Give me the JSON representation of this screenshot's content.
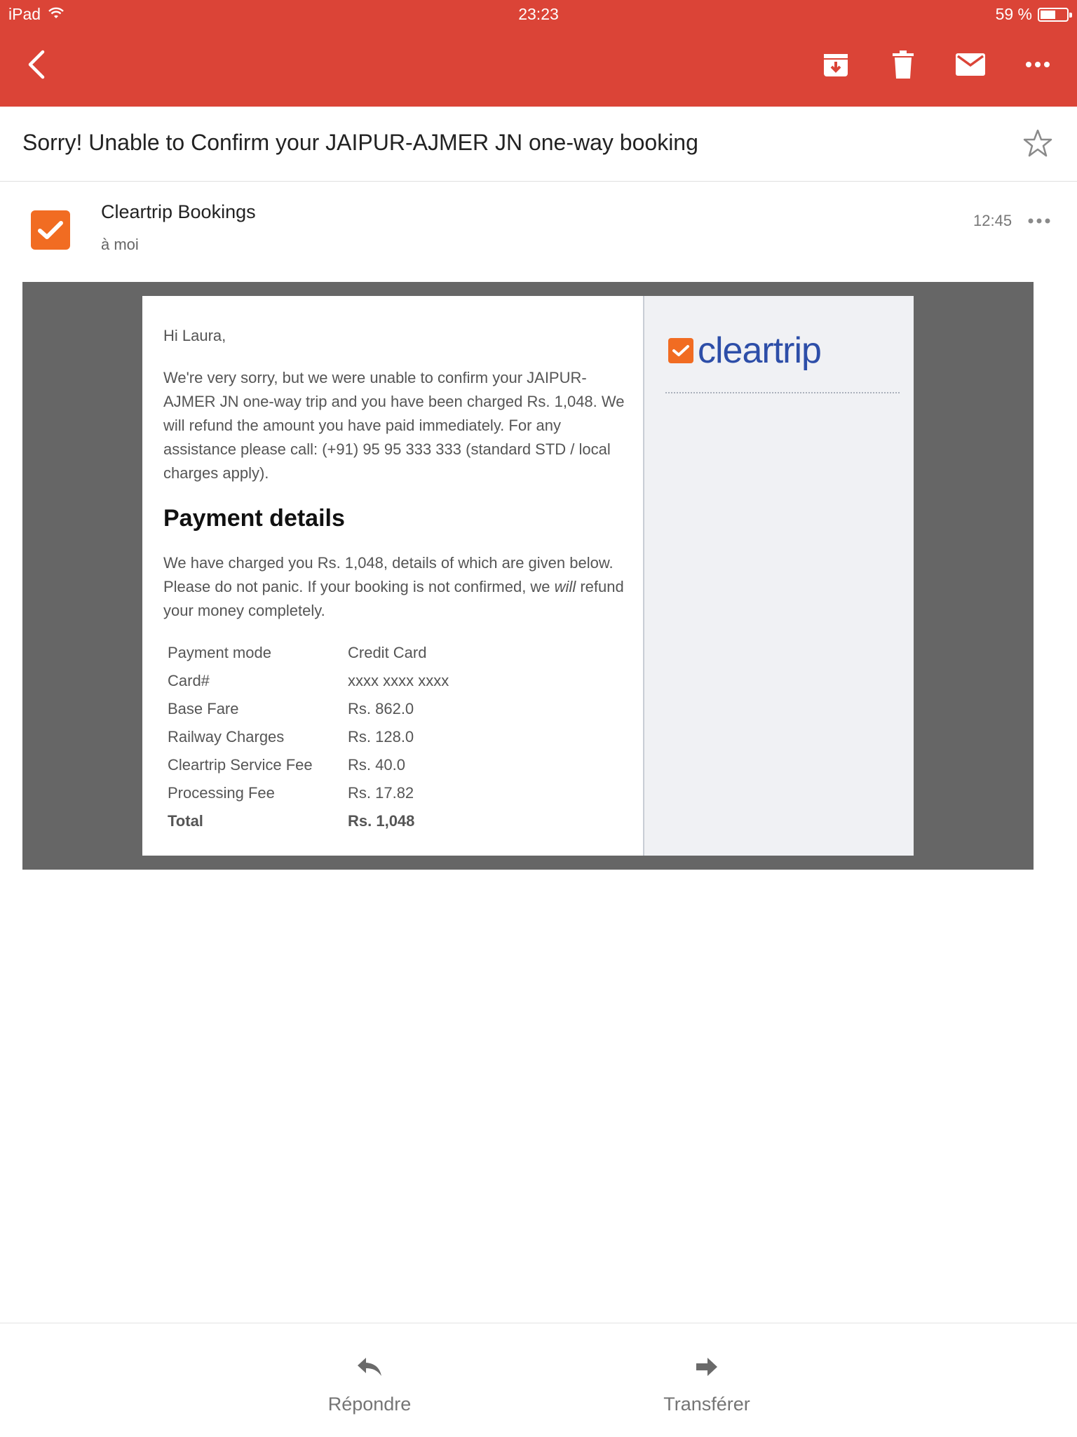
{
  "status_bar": {
    "device": "iPad",
    "time": "23:23",
    "battery": "59 %",
    "battery_level": 0.59
  },
  "toolbar": {
    "back_icon": "chevron-left-icon",
    "archive_icon": "archive-icon",
    "delete_icon": "trash-icon",
    "mark_unread_icon": "mail-icon",
    "more_icon": "more-horizontal-icon"
  },
  "message": {
    "subject": "Sorry! Unable to Confirm your JAIPUR-AJMER JN one-way booking",
    "sender_name": "Cleartrip Bookings",
    "recipient": "à moi",
    "time": "12:45"
  },
  "email_body": {
    "greeting": "Hi Laura,",
    "intro": "We're very sorry, but we were unable to confirm your JAIPUR-AJMER JN one-way trip and you have been charged Rs. 1,048. We will refund the amount you have paid immediately. For any assistance please call: (+91) 95 95 333 333 (standard STD / local charges apply).",
    "payment_heading": "Payment details",
    "payment_desc_pre": "We have charged you Rs. 1,048, details of which are given below. Please do not panic. If your booking is not confirmed, we ",
    "payment_desc_em": "will",
    "payment_desc_post": " refund your money completely.",
    "payment_rows": [
      {
        "label": "Payment mode",
        "value": "Credit Card"
      },
      {
        "label": "Card#",
        "value": "xxxx xxxx xxxx"
      },
      {
        "label": "Base Fare",
        "value": "Rs. 862.0"
      },
      {
        "label": "Railway Charges",
        "value": "Rs. 128.0"
      },
      {
        "label": "Cleartrip Service Fee",
        "value": "Rs. 40.0"
      },
      {
        "label": "Processing Fee",
        "value": "Rs. 17.82"
      },
      {
        "label": "Total",
        "value": "Rs. 1,048"
      }
    ],
    "brand_name": "cleartrip"
  },
  "colors": {
    "header_red": "#db4437",
    "brand_orange": "#f16c22",
    "brand_blue": "#2d4ea8"
  },
  "actions": {
    "reply_label": "Répondre",
    "forward_label": "Transférer"
  }
}
